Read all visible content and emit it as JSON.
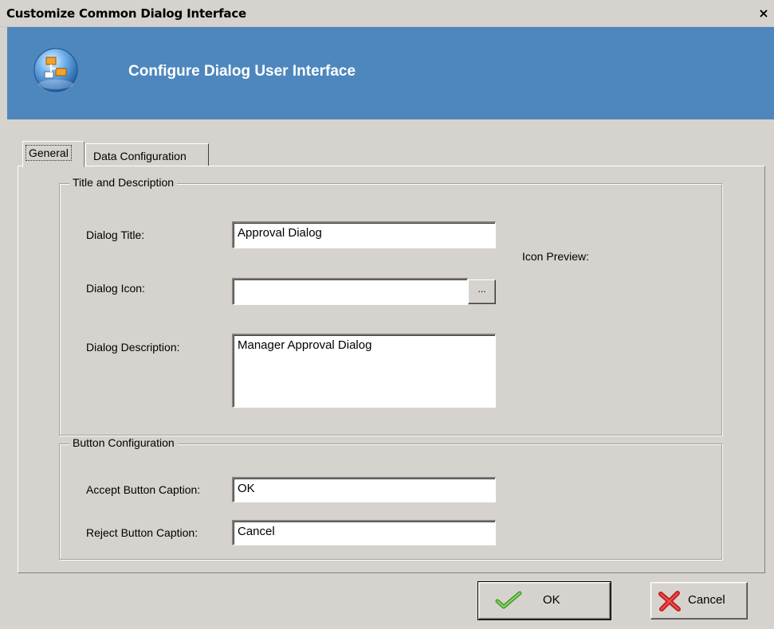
{
  "window": {
    "title": "Customize Common Dialog Interface",
    "close_label": "×"
  },
  "banner": {
    "title": "Configure Dialog User Interface",
    "icon": "dialog-config-icon",
    "color": "#4d87bd"
  },
  "tabs": [
    {
      "label": "General",
      "selected": true
    },
    {
      "label": "Data Configuration",
      "selected": false
    }
  ],
  "title_group": {
    "title": "Title and Description",
    "dialog_title_label": "Dialog Title:",
    "dialog_title_value": "Approval Dialog",
    "dialog_icon_label": "Dialog Icon:",
    "dialog_icon_value": "",
    "browse_label": "...",
    "icon_preview_label": "Icon Preview:",
    "dialog_description_label": "Dialog Description:",
    "dialog_description_value": "Manager Approval Dialog"
  },
  "button_group": {
    "title": "Button Configuration",
    "accept_label": "Accept Button Caption:",
    "accept_value": "OK",
    "reject_label": "Reject Button Caption:",
    "reject_value": "Cancel"
  },
  "footer": {
    "ok_label": "OK",
    "ok_icon": "checkmark-icon",
    "cancel_label": "Cancel",
    "cancel_icon": "red-x-icon"
  }
}
